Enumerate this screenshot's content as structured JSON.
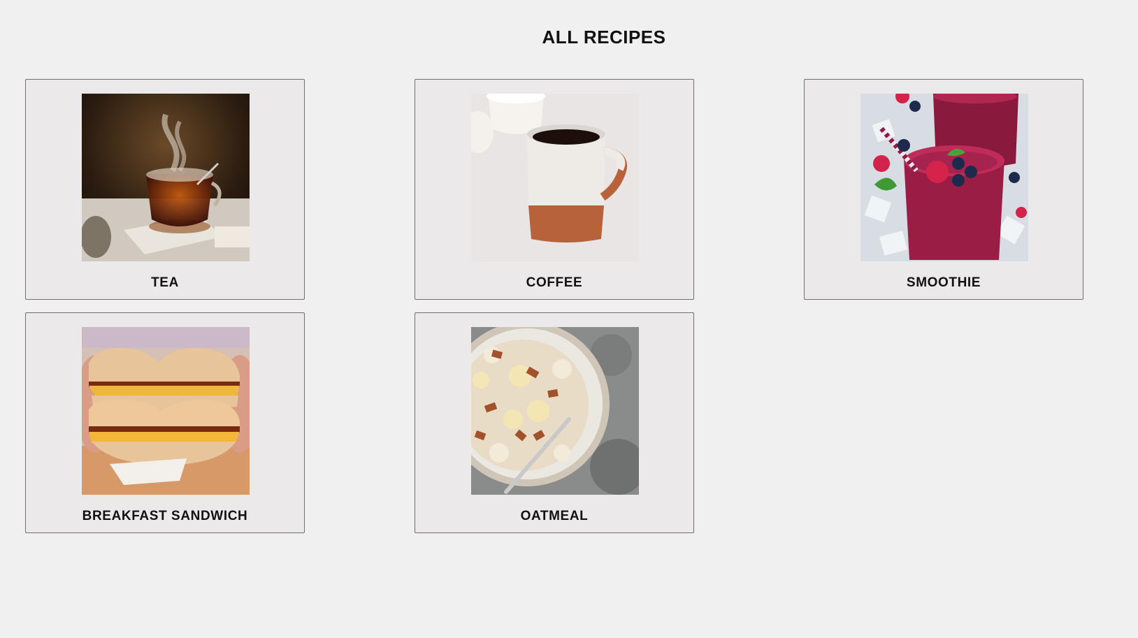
{
  "page": {
    "title": "ALL RECIPES"
  },
  "recipes": [
    {
      "label": "TEA",
      "image": "tea-photo"
    },
    {
      "label": "COFFEE",
      "image": "coffee-photo"
    },
    {
      "label": "SMOOTHIE",
      "image": "smoothie-photo"
    },
    {
      "label": "BREAKFAST SANDWICH",
      "image": "breakfast-sandwich-photo"
    },
    {
      "label": "OATMEAL",
      "image": "oatmeal-photo"
    }
  ],
  "colors": {
    "background": "#f0f0f0",
    "card_background": "#ebe9ea",
    "card_border": "#6f6f6f",
    "text": "#111111"
  }
}
